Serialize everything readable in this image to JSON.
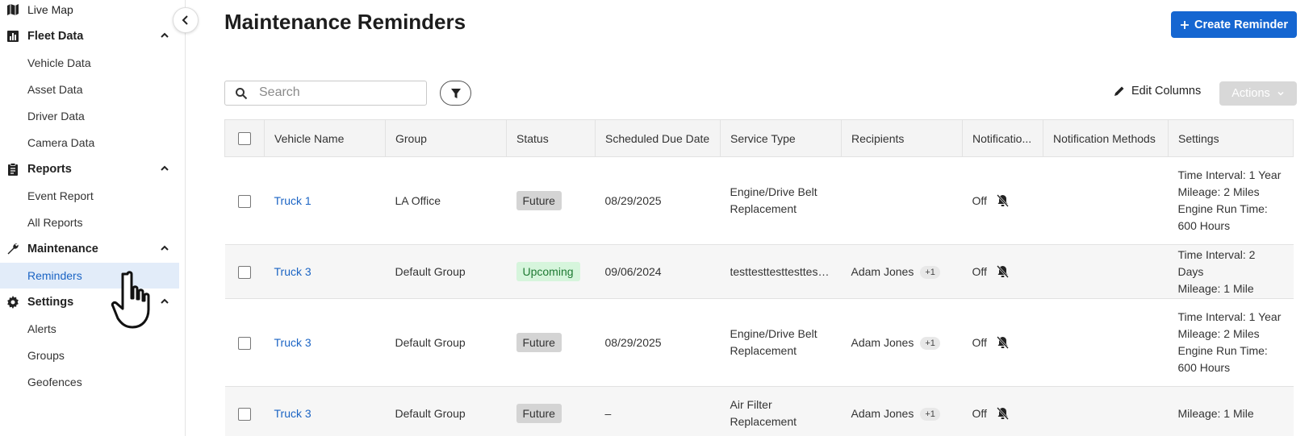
{
  "sidebar": {
    "items": [
      {
        "label": "Live Map",
        "type": "section-partial"
      },
      {
        "label": "Fleet Data",
        "type": "section"
      },
      {
        "label": "Vehicle Data",
        "type": "sub"
      },
      {
        "label": "Asset Data",
        "type": "sub"
      },
      {
        "label": "Driver Data",
        "type": "sub"
      },
      {
        "label": "Camera Data",
        "type": "sub"
      },
      {
        "label": "Reports",
        "type": "section"
      },
      {
        "label": "Event Report",
        "type": "sub"
      },
      {
        "label": "All Reports",
        "type": "sub"
      },
      {
        "label": "Maintenance",
        "type": "section"
      },
      {
        "label": "Reminders",
        "type": "sub",
        "active": true
      },
      {
        "label": "Settings",
        "type": "section"
      },
      {
        "label": "Alerts",
        "type": "sub"
      },
      {
        "label": "Groups",
        "type": "sub"
      },
      {
        "label": "Geofences",
        "type": "sub"
      }
    ]
  },
  "header": {
    "title": "Maintenance Reminders",
    "create_label": "Create Reminder"
  },
  "toolbar": {
    "search_placeholder": "Search",
    "edit_columns_label": "Edit Columns",
    "actions_label": "Actions"
  },
  "table": {
    "columns": [
      "Vehicle Name",
      "Group",
      "Status",
      "Scheduled Due Date",
      "Service Type",
      "Recipients",
      "Notificatio...",
      "Notification Methods",
      "Settings"
    ],
    "rows": [
      {
        "vehicle": "Truck 1",
        "group": "LA Office",
        "status": "Future",
        "due": "08/29/2025",
        "service": "Engine/Drive Belt Replacement",
        "recipient": "",
        "recipient_extra": "",
        "notification": "Off",
        "methods": "",
        "settings": [
          "Time Interval: 1 Year",
          "Mileage: 2 Miles",
          "Engine Run Time: 600 Hours"
        ]
      },
      {
        "vehicle": "Truck 3",
        "group": "Default Group",
        "status": "Upcoming",
        "due": "09/06/2024",
        "service": "testtesttesttesttesttest",
        "recipient": "Adam Jones",
        "recipient_extra": "+1",
        "notification": "Off",
        "methods": "",
        "settings": [
          "Time Interval: 2 Days",
          "Mileage: 1 Mile"
        ]
      },
      {
        "vehicle": "Truck 3",
        "group": "Default Group",
        "status": "Future",
        "due": "08/29/2025",
        "service": "Engine/Drive Belt Replacement",
        "recipient": "Adam Jones",
        "recipient_extra": "+1",
        "notification": "Off",
        "methods": "",
        "settings": [
          "Time Interval: 1 Year",
          "Mileage: 2 Miles",
          "Engine Run Time: 600 Hours"
        ]
      },
      {
        "vehicle": "Truck 3",
        "group": "Default Group",
        "status": "Future",
        "due": "–",
        "service": "Air Filter Replacement",
        "recipient": "Adam Jones",
        "recipient_extra": "+1",
        "notification": "Off",
        "methods": "",
        "settings": [
          "Mileage: 1 Mile"
        ]
      }
    ]
  },
  "colors": {
    "primary": "#1566d1",
    "link": "#1b64c4",
    "active_bg": "#e2ecf9",
    "upcoming_bg": "#d6f5dc",
    "future_bg": "#d4d4d4"
  }
}
